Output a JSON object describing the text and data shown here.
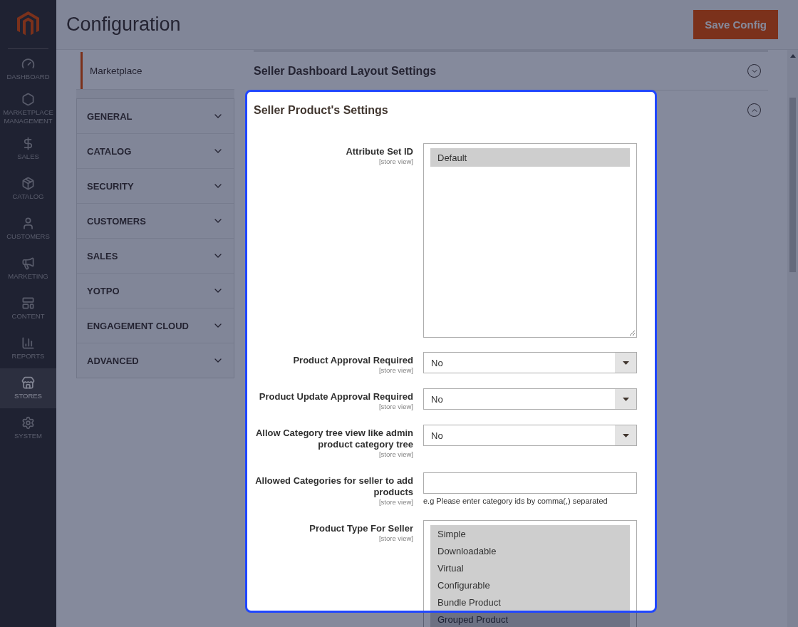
{
  "menu": [
    {
      "label": "DASHBOARD",
      "selected": false
    },
    {
      "label": "MARKETPLACE MANAGEMENT",
      "selected": false
    },
    {
      "label": "SALES",
      "selected": false
    },
    {
      "label": "CATALOG",
      "selected": false
    },
    {
      "label": "CUSTOMERS",
      "selected": false
    },
    {
      "label": "MARKETING",
      "selected": false
    },
    {
      "label": "CONTENT",
      "selected": false
    },
    {
      "label": "REPORTS",
      "selected": false
    },
    {
      "label": "STORES",
      "selected": true
    },
    {
      "label": "SYSTEM",
      "selected": false
    }
  ],
  "page_title": "Configuration",
  "save_button": "Save Config",
  "config_tabs": {
    "current": {
      "label": "Marketplace",
      "selected": true
    },
    "groups": [
      {
        "label": "GENERAL",
        "expanded": false
      },
      {
        "label": "CATALOG",
        "expanded": false
      },
      {
        "label": "SECURITY",
        "expanded": false
      },
      {
        "label": "CUSTOMERS",
        "expanded": false
      },
      {
        "label": "SALES",
        "expanded": false
      },
      {
        "label": "YOTPO",
        "expanded": false
      },
      {
        "label": "ENGAGEMENT CLOUD",
        "expanded": false
      },
      {
        "label": "ADVANCED",
        "expanded": false
      }
    ]
  },
  "sections": [
    {
      "title": "Seller Dashboard Layout Settings",
      "expanded": false,
      "highlighted": false
    },
    {
      "title": "Seller Product's Settings",
      "expanded": true,
      "highlighted": true,
      "fields": [
        {
          "kind": "multiselect",
          "label": "Attribute Set ID",
          "scope": "[store view]",
          "options": [
            {
              "label": "Default",
              "selected": true
            }
          ]
        },
        {
          "kind": "select",
          "label": "Product Approval Required",
          "scope": "[store view]",
          "value": "No"
        },
        {
          "kind": "select",
          "label": "Product Update Approval Required",
          "scope": "[store view]",
          "value": "No"
        },
        {
          "kind": "select",
          "label": "Allow Category tree view like admin product category tree",
          "scope": "[store view]",
          "value": "No"
        },
        {
          "kind": "text",
          "label": "Allowed Categories for seller to add products",
          "scope": "[store view]",
          "note": "e.g Please enter category ids by comma(,) separated"
        },
        {
          "kind": "multiselect",
          "label": "Product Type For Seller",
          "scope": "[store view]",
          "options": [
            {
              "label": "Simple",
              "selected": true
            },
            {
              "label": "Downloadable",
              "selected": true
            },
            {
              "label": "Virtual",
              "selected": true
            },
            {
              "label": "Configurable",
              "selected": true
            },
            {
              "label": "Bundle Product",
              "selected": true
            },
            {
              "label": "Grouped Product",
              "selected": true
            }
          ]
        }
      ]
    }
  ]
}
